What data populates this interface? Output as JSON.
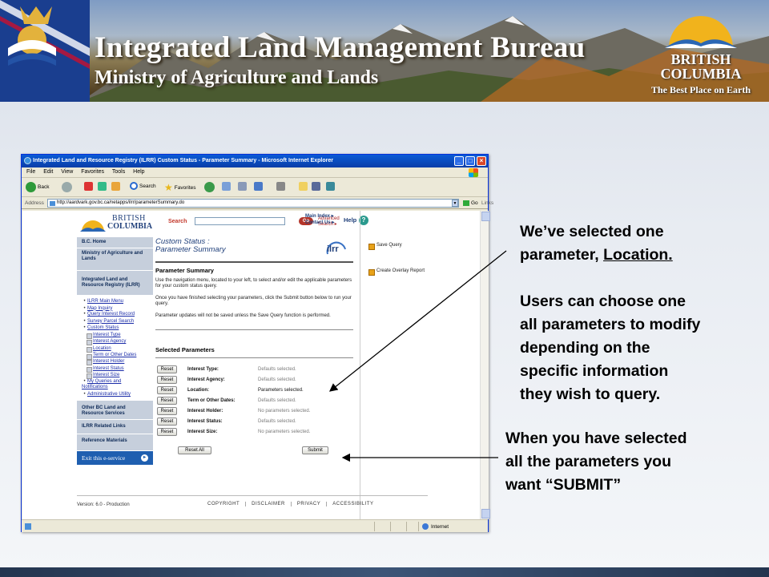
{
  "banner": {
    "title": "Integrated Land Management Bureau",
    "subtitle": "Ministry of Agriculture and Lands",
    "bc_logo": {
      "line1": "BRITISH",
      "line2": "COLUMBIA",
      "tagline": "The Best Place on Earth"
    }
  },
  "browser": {
    "title": "Integrated Land and Resource Registry (ILRR) Custom Status - Parameter Summary - Microsoft Internet Explorer",
    "menu": [
      "File",
      "Edit",
      "View",
      "Favorites",
      "Tools",
      "Help"
    ],
    "toolbar": {
      "back": "Back",
      "search": "Search",
      "favorites": "Favorites"
    },
    "address_label": "Address",
    "address": "http://aardvark.gov.bc.ca/netapps/ilrr/parameterSummary.do",
    "go": "Go",
    "links": "Links",
    "status_zone": "Internet"
  },
  "page": {
    "logo": {
      "line1": "BRITISH",
      "line2": "COLUMBIA"
    },
    "search_label": "Search",
    "go_button": "Go",
    "advanced_search": [
      "Advanced",
      "Search ▸"
    ],
    "main_index": "Main Index ▸",
    "contact_us": "Contact Us ▸",
    "help": "Help",
    "help_icon": "?",
    "nav_blocks_top": [
      "B.C. Home",
      "Ministry of Agriculture and Lands",
      "Integrated Land and Resource Registry (ILRR)"
    ],
    "nav_links": [
      "ILRR Main Menu",
      "Map Inquiry",
      "Query Interest Record",
      "Survey Parcel Search",
      "Custom Status"
    ],
    "nav_sub": [
      "Interest Type",
      "Interest Agency",
      "Location",
      "Term or Other Dates",
      "Interest Holder",
      "Interest Status",
      "Interest Size"
    ],
    "nav_links_after": [
      "My Queries and Notifications",
      "Administrative Utility"
    ],
    "nav_blocks_bottom": [
      "Other BC Land and Resource Services",
      "ILRR Related Links",
      "Reference Materials"
    ],
    "exit_label": "Exit this e-service",
    "page_title_line1": "Custom Status :",
    "page_title_line2": "Parameter Summary",
    "ilrr_logo": "ilrr",
    "summary_heading": "Parameter Summary",
    "summary_para1": "Use the navigation menu, located to your left, to select and/or edit the applicable parameters for your custom status query.",
    "summary_para2": "Once you have finished selecting your parameters, click the Submit button below to run your query.",
    "summary_para3": "Parameter updates will not be saved unless the Save Query function is performed.",
    "selected_heading": "Selected Parameters",
    "reset_label": "Reset",
    "parameters": [
      {
        "name": "Interest Type:",
        "value": "Defaults selected."
      },
      {
        "name": "Interest Agency:",
        "value": "Defaults selected."
      },
      {
        "name": "Location:",
        "value": "Parameters selected."
      },
      {
        "name": "Term or Other Dates:",
        "value": "Defaults selected."
      },
      {
        "name": "Interest Holder:",
        "value": "No parameters selected."
      },
      {
        "name": "Interest Status:",
        "value": "Defaults selected."
      },
      {
        "name": "Interest Size:",
        "value": "No parameters selected."
      }
    ],
    "reset_all": "Reset All",
    "submit": "Submit",
    "right_actions": [
      "Save Query",
      "Create Overlay Report"
    ],
    "version": "Version: 6.0 - Production",
    "footer_links": [
      "COPYRIGHT",
      "DISCLAIMER",
      "PRIVACY",
      "ACCESSIBILITY"
    ]
  },
  "callouts": {
    "c1_line1": "We’ve selected one",
    "c1_line2a": "parameter, ",
    "c1_line2b": "Location.",
    "c2_lines": [
      "Users can choose one",
      "all parameters to modify",
      "depending on the",
      "specific information",
      "they wish to query."
    ],
    "c3_lines": [
      "When you have selected",
      "all the parameters you",
      "want  “SUBMIT”"
    ]
  }
}
